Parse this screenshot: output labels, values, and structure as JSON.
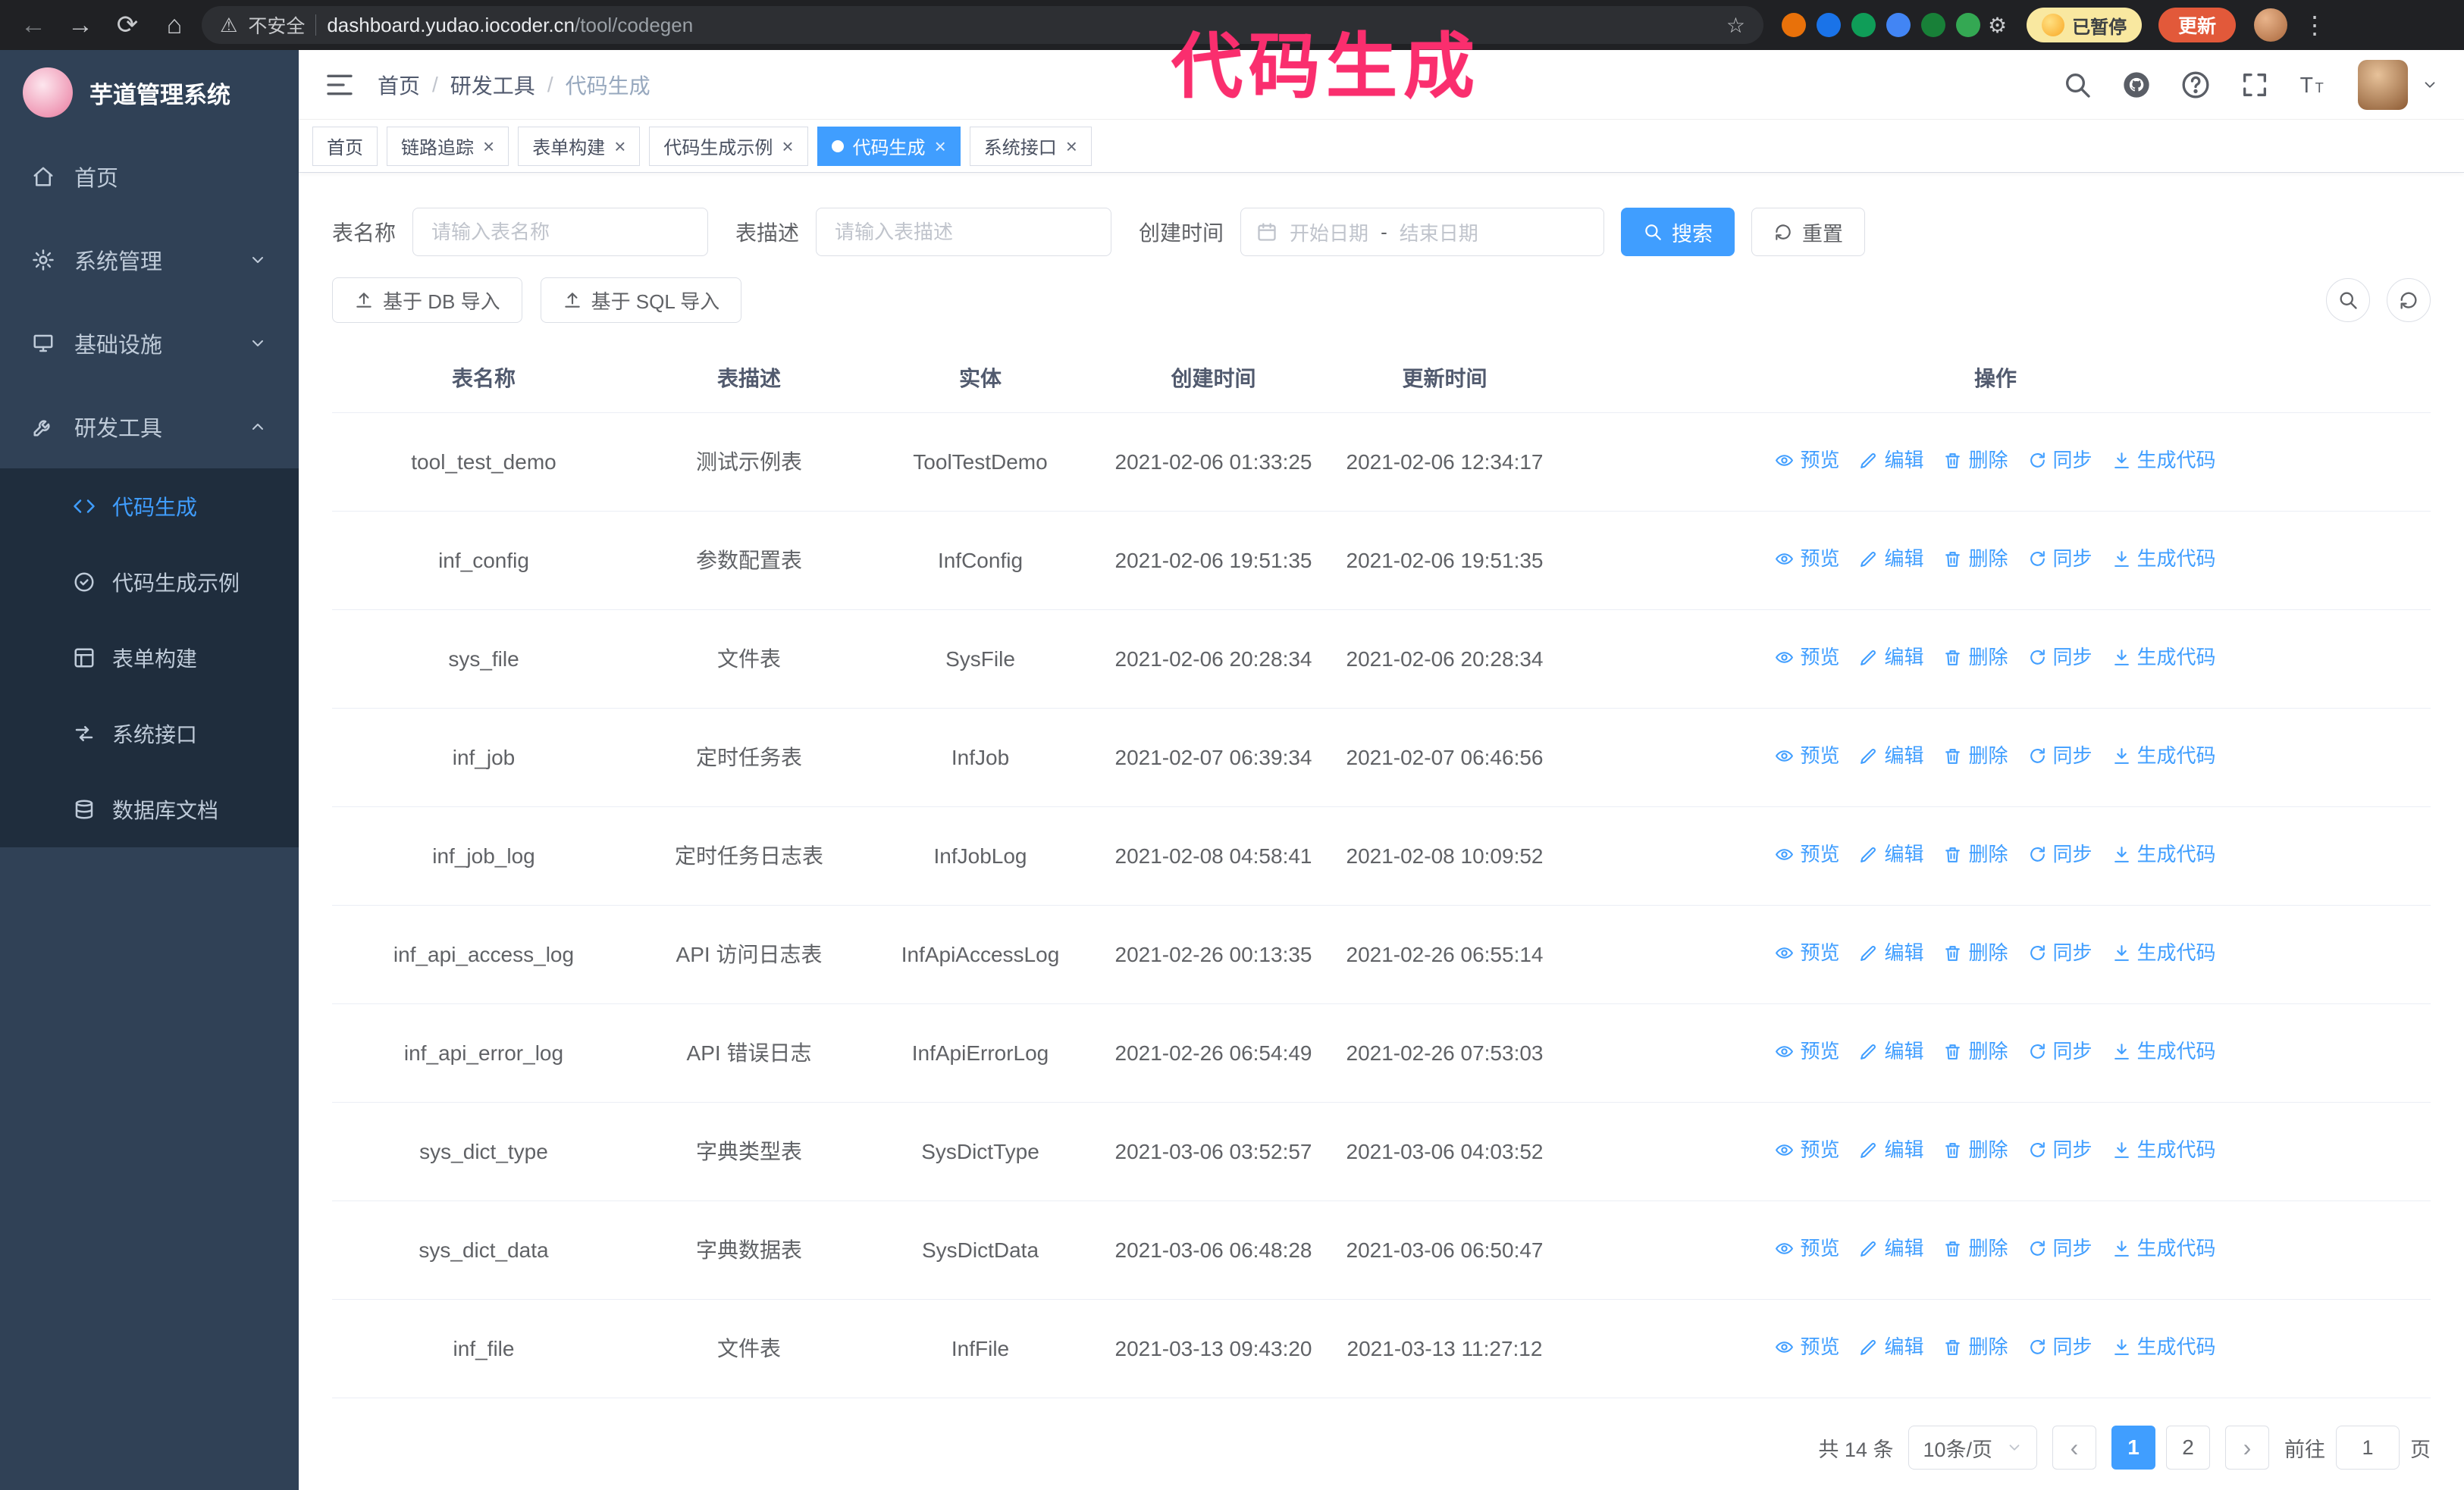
{
  "colors": {
    "accent": "#409eff",
    "annotation": "#fa2e6e"
  },
  "annotation_text": "代码生成",
  "browser": {
    "security_warning": "不安全",
    "url_host": "dashboard.yudao.iocoder.cn",
    "url_path": "/tool/codegen",
    "paused_badge": "已暂停",
    "update_button": "更新",
    "extension_colors": [
      "#e8710a",
      "#1a73e8",
      "#0f9d58",
      "#4285f4",
      "#188038",
      "#34a853"
    ]
  },
  "sidebar": {
    "logo_title": "芋道管理系统",
    "items": [
      {
        "name": "home",
        "label": "首页",
        "icon": "home-icon",
        "expandable": false,
        "expanded": false
      },
      {
        "name": "system",
        "label": "系统管理",
        "icon": "gear-icon",
        "expandable": true,
        "expanded": false
      },
      {
        "name": "infra",
        "label": "基础设施",
        "icon": "monitor-icon",
        "expandable": true,
        "expanded": false
      },
      {
        "name": "dev-tools",
        "label": "研发工具",
        "icon": "wrench-icon",
        "expandable": true,
        "expanded": true
      }
    ],
    "sub_items": [
      {
        "name": "codegen",
        "label": "代码生成",
        "icon": "code-icon",
        "active": true
      },
      {
        "name": "codegen-example",
        "label": "代码生成示例",
        "icon": "example-icon",
        "active": false
      },
      {
        "name": "form-builder",
        "label": "表单构建",
        "icon": "form-icon",
        "active": false
      },
      {
        "name": "api",
        "label": "系统接口",
        "icon": "api-icon",
        "active": false
      },
      {
        "name": "db-doc",
        "label": "数据库文档",
        "icon": "db-doc-icon",
        "active": false
      }
    ]
  },
  "header": {
    "breadcrumb": [
      "首页",
      "研发工具",
      "代码生成"
    ],
    "icons": [
      "search-icon",
      "github-icon",
      "help-icon",
      "fullscreen-icon",
      "font-size-icon"
    ]
  },
  "tabs": [
    {
      "name": "home",
      "label": "首页",
      "closable": false,
      "active": false
    },
    {
      "name": "trace",
      "label": "链路追踪",
      "closable": true,
      "active": false
    },
    {
      "name": "form-builder",
      "label": "表单构建",
      "closable": true,
      "active": false
    },
    {
      "name": "codegen-example",
      "label": "代码生成示例",
      "closable": true,
      "active": false
    },
    {
      "name": "codegen",
      "label": "代码生成",
      "closable": true,
      "active": true
    },
    {
      "name": "api",
      "label": "系统接口",
      "closable": true,
      "active": false
    }
  ],
  "filters": {
    "table_name_label": "表名称",
    "table_name_placeholder": "请输入表名称",
    "table_desc_label": "表描述",
    "table_desc_placeholder": "请输入表描述",
    "create_time_label": "创建时间",
    "start_date_placeholder": "开始日期",
    "date_separator": "-",
    "end_date_placeholder": "结束日期",
    "search_button": "搜索",
    "reset_button": "重置"
  },
  "toolbar": {
    "import_db_button": "基于 DB 导入",
    "import_sql_button": "基于 SQL 导入"
  },
  "table": {
    "columns": [
      "表名称",
      "表描述",
      "实体",
      "创建时间",
      "更新时间",
      "操作"
    ],
    "row_actions": [
      {
        "name": "preview",
        "label": "预览",
        "icon": "eye-icon"
      },
      {
        "name": "edit",
        "label": "编辑",
        "icon": "edit-icon"
      },
      {
        "name": "delete",
        "label": "删除",
        "icon": "delete-icon"
      },
      {
        "name": "sync",
        "label": "同步",
        "icon": "sync-icon"
      },
      {
        "name": "generate-code",
        "label": "生成代码",
        "icon": "download-icon"
      }
    ],
    "rows": [
      {
        "name": "tool_test_demo",
        "desc": "测试示例表",
        "entity": "ToolTestDemo",
        "created": "2021-02-06 01:33:25",
        "updated": "2021-02-06 12:34:17"
      },
      {
        "name": "inf_config",
        "desc": "参数配置表",
        "entity": "InfConfig",
        "created": "2021-02-06 19:51:35",
        "updated": "2021-02-06 19:51:35"
      },
      {
        "name": "sys_file",
        "desc": "文件表",
        "entity": "SysFile",
        "created": "2021-02-06 20:28:34",
        "updated": "2021-02-06 20:28:34"
      },
      {
        "name": "inf_job",
        "desc": "定时任务表",
        "entity": "InfJob",
        "created": "2021-02-07 06:39:34",
        "updated": "2021-02-07 06:46:56"
      },
      {
        "name": "inf_job_log",
        "desc": "定时任务日志表",
        "entity": "InfJobLog",
        "created": "2021-02-08 04:58:41",
        "updated": "2021-02-08 10:09:52"
      },
      {
        "name": "inf_api_access_log",
        "desc": "API 访问日志表",
        "entity": "InfApiAccessLog",
        "created": "2021-02-26 00:13:35",
        "updated": "2021-02-26 06:55:14"
      },
      {
        "name": "inf_api_error_log",
        "desc": "API 错误日志",
        "entity": "InfApiErrorLog",
        "created": "2021-02-26 06:54:49",
        "updated": "2021-02-26 07:53:03"
      },
      {
        "name": "sys_dict_type",
        "desc": "字典类型表",
        "entity": "SysDictType",
        "created": "2021-03-06 03:52:57",
        "updated": "2021-03-06 04:03:52"
      },
      {
        "name": "sys_dict_data",
        "desc": "字典数据表",
        "entity": "SysDictData",
        "created": "2021-03-06 06:48:28",
        "updated": "2021-03-06 06:50:47"
      },
      {
        "name": "inf_file",
        "desc": "文件表",
        "entity": "InfFile",
        "created": "2021-03-13 09:43:20",
        "updated": "2021-03-13 11:27:12"
      }
    ]
  },
  "pagination": {
    "total_text": "共 14 条",
    "page_size": "10条/页",
    "pages": [
      "1",
      "2"
    ],
    "active_page": "1",
    "goto_label": "前往",
    "goto_value": "1",
    "goto_suffix": "页"
  }
}
